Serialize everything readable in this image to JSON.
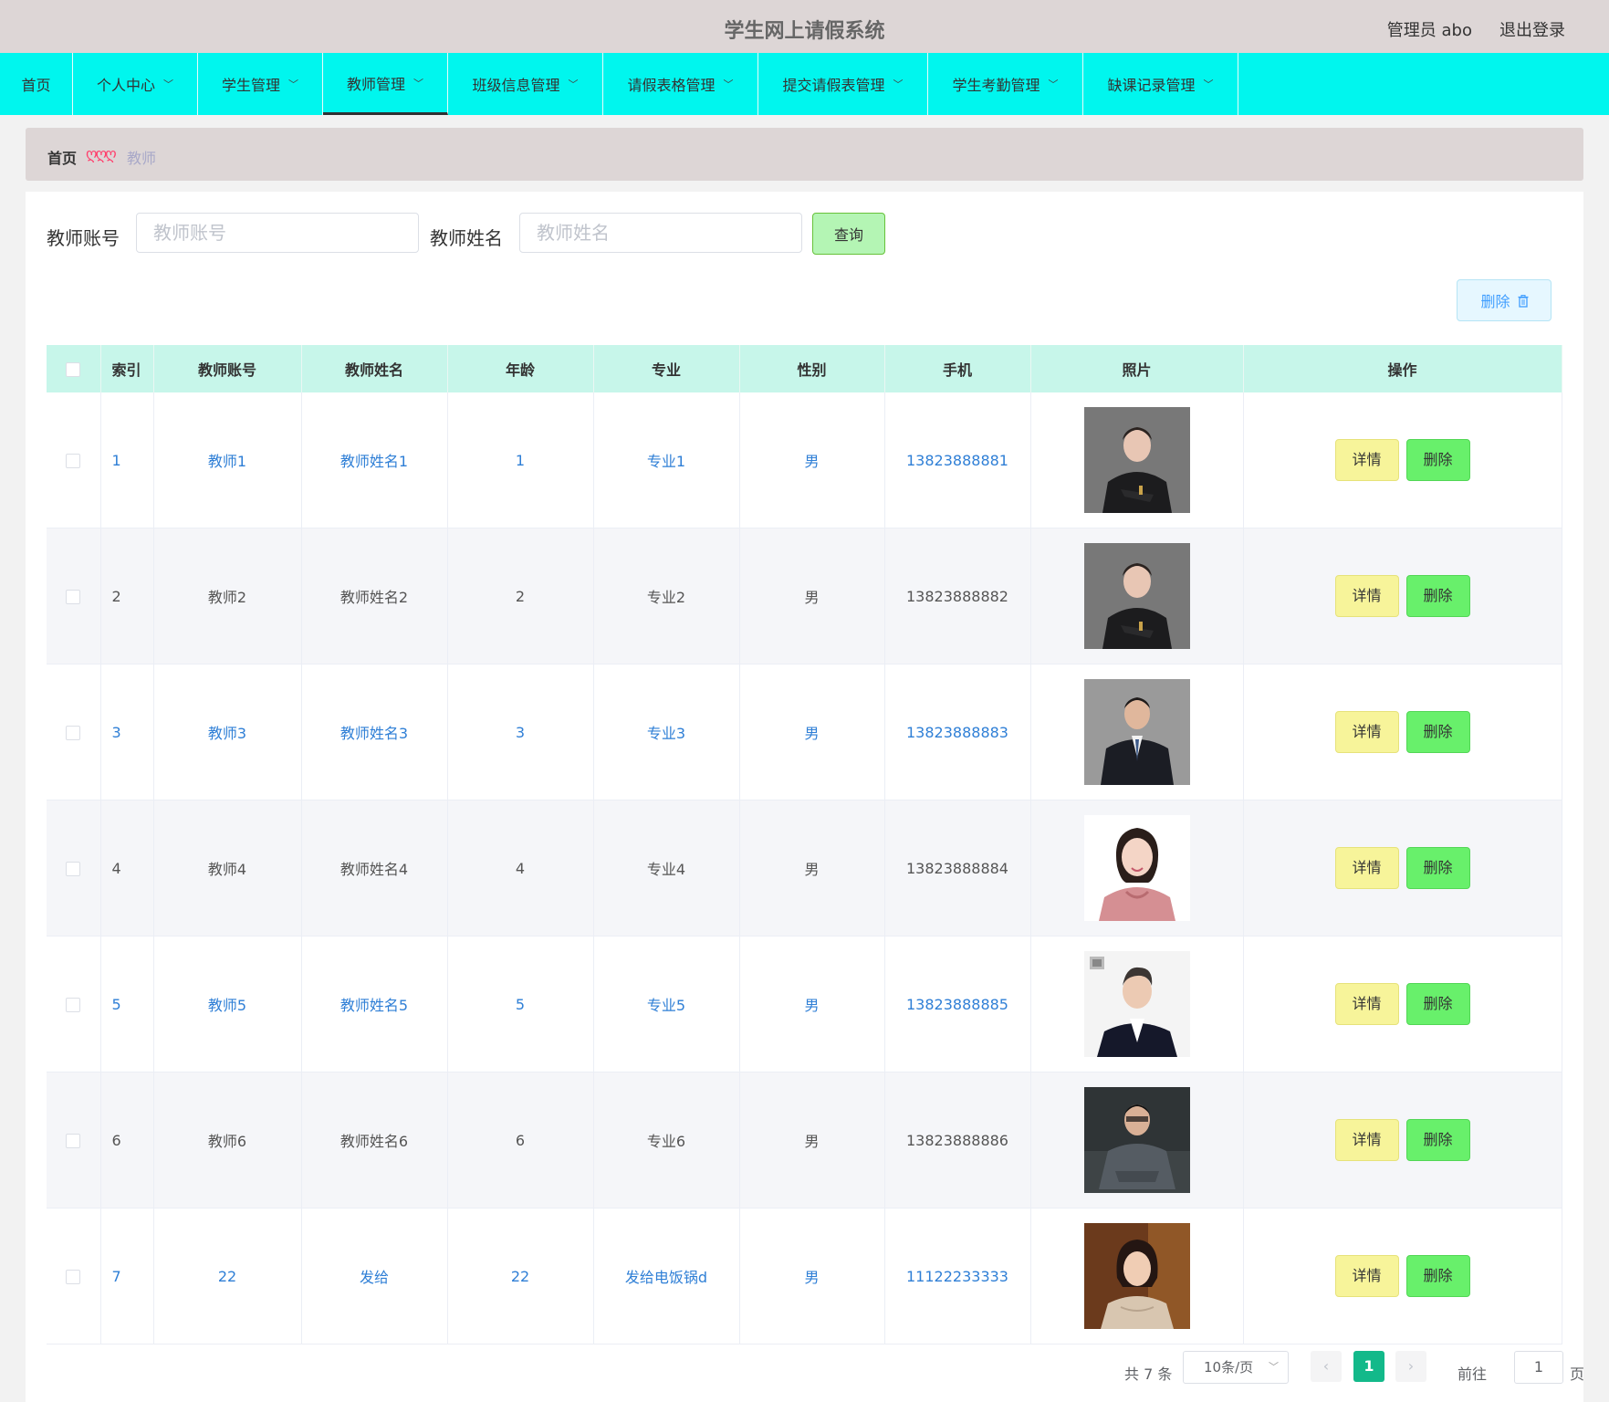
{
  "header": {
    "title": "学生网上请假系统",
    "user_label": "管理员 abo",
    "logout_label": "退出登录"
  },
  "nav": {
    "items": [
      {
        "label": "首页",
        "has_dropdown": false,
        "active": false
      },
      {
        "label": "个人中心",
        "has_dropdown": true,
        "active": false
      },
      {
        "label": "学生管理",
        "has_dropdown": true,
        "active": false
      },
      {
        "label": "教师管理",
        "has_dropdown": true,
        "active": true
      },
      {
        "label": "班级信息管理",
        "has_dropdown": true,
        "active": false
      },
      {
        "label": "请假表格管理",
        "has_dropdown": true,
        "active": false
      },
      {
        "label": "提交请假表管理",
        "has_dropdown": true,
        "active": false
      },
      {
        "label": "学生考勤管理",
        "has_dropdown": true,
        "active": false
      },
      {
        "label": "缺课记录管理",
        "has_dropdown": true,
        "active": false
      }
    ]
  },
  "breadcrumb": {
    "home": "首页",
    "separator": "ღღღ",
    "current": "教师"
  },
  "search": {
    "account_label": "教师账号",
    "account_placeholder": "教师账号",
    "account_value": "",
    "name_label": "教师姓名",
    "name_placeholder": "教师姓名",
    "name_value": "",
    "query_label": "查询"
  },
  "toolbar": {
    "bulk_delete_label": "删除"
  },
  "table": {
    "columns": [
      "索引",
      "教师账号",
      "教师姓名",
      "年龄",
      "专业",
      "性别",
      "手机",
      "照片",
      "操作"
    ],
    "rows": [
      {
        "index": "1",
        "account": "教师1",
        "name": "教师姓名1",
        "age": "1",
        "major": "专业1",
        "gender": "男",
        "phone": "13823888881",
        "photo": "portrait-woman-dark-suit"
      },
      {
        "index": "2",
        "account": "教师2",
        "name": "教师姓名2",
        "age": "2",
        "major": "专业2",
        "gender": "男",
        "phone": "13823888882",
        "photo": "portrait-woman-dark-suit"
      },
      {
        "index": "3",
        "account": "教师3",
        "name": "教师姓名3",
        "age": "3",
        "major": "专业3",
        "gender": "男",
        "phone": "13823888883",
        "photo": "portrait-man-suit-gray"
      },
      {
        "index": "4",
        "account": "教师4",
        "name": "教师姓名4",
        "age": "4",
        "major": "专业4",
        "gender": "男",
        "phone": "13823888884",
        "photo": "portrait-woman-pink-blouse"
      },
      {
        "index": "5",
        "account": "教师5",
        "name": "教师姓名5",
        "age": "5",
        "major": "专业5",
        "gender": "男",
        "phone": "13823888885",
        "photo": "portrait-man-white-background"
      },
      {
        "index": "6",
        "account": "教师6",
        "name": "教师姓名6",
        "age": "6",
        "major": "专业6",
        "gender": "男",
        "phone": "13823888886",
        "photo": "portrait-man-seated-dark"
      },
      {
        "index": "7",
        "account": "22",
        "name": "发给",
        "age": "22",
        "major": "发给电饭锅d",
        "gender": "男",
        "phone": "11122233333",
        "photo": "portrait-woman-warm-light"
      }
    ],
    "detail_label": "详情",
    "delete_label": "删除"
  },
  "pagination": {
    "total_label": "共 7 条",
    "page_size_label": "10条/页",
    "prev_icon": "‹",
    "next_icon": "›",
    "current_page": "1",
    "goto_label": "前往",
    "goto_value": "1",
    "goto_unit": "页"
  },
  "colors": {
    "navbar": "#00f6ee",
    "header": "#ddd6d6",
    "table_header": "#c7f6ea",
    "link_text": "#2f7fd6",
    "detail_button": "#f7f49a",
    "delete_button": "#68f06b",
    "query_button": "#b4f5b4",
    "current_page": "#13b98a"
  }
}
